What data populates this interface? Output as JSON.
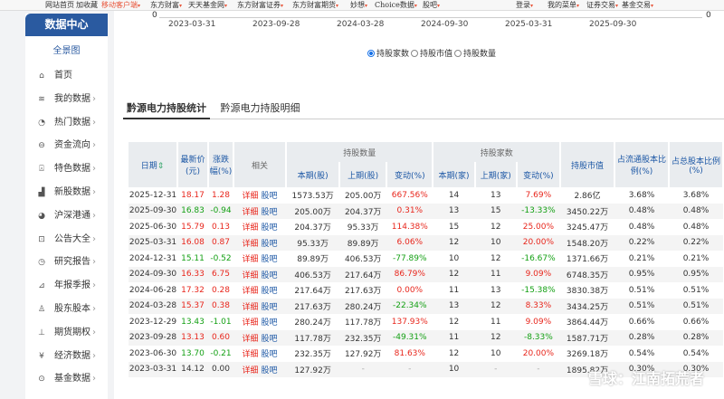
{
  "topnav": {
    "left": [
      "网站首页",
      "加收藏",
      "移动客户端",
      "东方财富",
      "天天基金网",
      "东方财富证券",
      "东方财富期货",
      "妙想",
      "Choice数据",
      "股吧"
    ],
    "right": [
      "登录",
      "我的菜单",
      "证券交易",
      "基金交易"
    ]
  },
  "sidebar": {
    "title": "数据中心",
    "overview": "全景图",
    "items": [
      {
        "label": "首页",
        "icon": "home-icon"
      },
      {
        "label": "我的数据",
        "icon": "layers-icon"
      },
      {
        "label": "热门数据",
        "icon": "gauge-icon"
      },
      {
        "label": "资金流向",
        "icon": "flow-icon"
      },
      {
        "label": "特色数据",
        "icon": "bookmark-icon"
      },
      {
        "label": "新股数据",
        "icon": "bar-icon"
      },
      {
        "label": "沪深港通",
        "icon": "globe-icon"
      },
      {
        "label": "公告大全",
        "icon": "notice-icon"
      },
      {
        "label": "研究报告",
        "icon": "pie-icon"
      },
      {
        "label": "年报季报",
        "icon": "chart-icon"
      },
      {
        "label": "股东股本",
        "icon": "user-icon"
      },
      {
        "label": "期货期权",
        "icon": "futures-icon"
      },
      {
        "label": "经济数据",
        "icon": "yen-icon"
      },
      {
        "label": "基金数据",
        "icon": "fund-icon"
      }
    ]
  },
  "chart": {
    "y_left": "0",
    "y_right": "0",
    "x_ticks": [
      "2023-03-31",
      "2023-09-28",
      "2024-03-28",
      "2024-09-30",
      "2025-03-31",
      "2025-09-30"
    ],
    "radios": [
      "持股家数",
      "持股市值",
      "持股数量"
    ],
    "selected": "持股家数"
  },
  "tabs": [
    "黔源电力持股统计",
    "黔源电力持股明细"
  ],
  "table": {
    "headers": {
      "date": "日期",
      "price": "最新价(元)",
      "change": "涨跌幅(%)",
      "related": "相关",
      "qty_group": "持股数量",
      "qty_cur": "本期(股)",
      "qty_prev": "上期(股)",
      "qty_chg": "变动(%)",
      "hold_group": "持股家数",
      "hold_cur": "本期(家)",
      "hold_prev": "上期(家)",
      "hold_chg": "变动(%)",
      "mv": "持股市值",
      "float_ratio": "占流通股本比例(%)",
      "total_ratio": "占总股本比例(%)"
    },
    "link_detail": "详细",
    "link_guba": "股吧",
    "rows": [
      [
        "2025-12-31",
        "18.17",
        "1.28",
        "1573.53万",
        "205.00万",
        "667.56%",
        "14",
        "13",
        "7.69%",
        "2.86亿",
        "3.68%",
        "3.68%"
      ],
      [
        "2025-09-30",
        "16.83",
        "-0.94",
        "205.00万",
        "204.37万",
        "0.31%",
        "13",
        "15",
        "-13.33%",
        "3450.22万",
        "0.48%",
        "0.48%"
      ],
      [
        "2025-06-30",
        "15.79",
        "0.13",
        "204.37万",
        "95.33万",
        "114.38%",
        "15",
        "12",
        "25.00%",
        "3245.47万",
        "0.48%",
        "0.48%"
      ],
      [
        "2025-03-31",
        "16.08",
        "0.87",
        "95.33万",
        "89.89万",
        "6.06%",
        "12",
        "10",
        "20.00%",
        "1548.20万",
        "0.22%",
        "0.22%"
      ],
      [
        "2024-12-31",
        "15.11",
        "-0.52",
        "89.89万",
        "406.53万",
        "-77.89%",
        "10",
        "12",
        "-16.67%",
        "1371.66万",
        "0.21%",
        "0.21%"
      ],
      [
        "2024-09-30",
        "16.33",
        "6.75",
        "406.53万",
        "217.64万",
        "86.79%",
        "12",
        "11",
        "9.09%",
        "6748.35万",
        "0.95%",
        "0.95%"
      ],
      [
        "2024-06-28",
        "17.32",
        "0.28",
        "217.64万",
        "217.63万",
        "0.00%",
        "11",
        "13",
        "-15.38%",
        "3830.38万",
        "0.51%",
        "0.51%"
      ],
      [
        "2024-03-28",
        "15.37",
        "0.38",
        "217.63万",
        "280.24万",
        "-22.34%",
        "13",
        "12",
        "8.33%",
        "3434.25万",
        "0.51%",
        "0.51%"
      ],
      [
        "2023-12-29",
        "13.43",
        "-1.01",
        "280.24万",
        "117.78万",
        "137.93%",
        "12",
        "11",
        "9.09%",
        "3864.44万",
        "0.66%",
        "0.66%"
      ],
      [
        "2023-09-28",
        "13.13",
        "0.60",
        "117.78万",
        "232.35万",
        "-49.31%",
        "11",
        "12",
        "-8.33%",
        "1587.71万",
        "0.28%",
        "0.28%"
      ],
      [
        "2023-06-30",
        "13.70",
        "-0.21",
        "232.35万",
        "127.92万",
        "81.63%",
        "12",
        "10",
        "20.00%",
        "3269.18万",
        "0.54%",
        "0.54%"
      ],
      [
        "2023-03-31",
        "14.12",
        "0.00",
        "127.92万",
        "-",
        "-",
        "10",
        "-",
        "-",
        "1895.82万",
        "0.30%",
        "0.30%"
      ]
    ]
  },
  "watermark": "雪球：江南拓荒者",
  "colors": {
    "up": "#e8261c",
    "down": "#14a014",
    "brand": "#2a5aa0",
    "link": "#1c57a5"
  }
}
